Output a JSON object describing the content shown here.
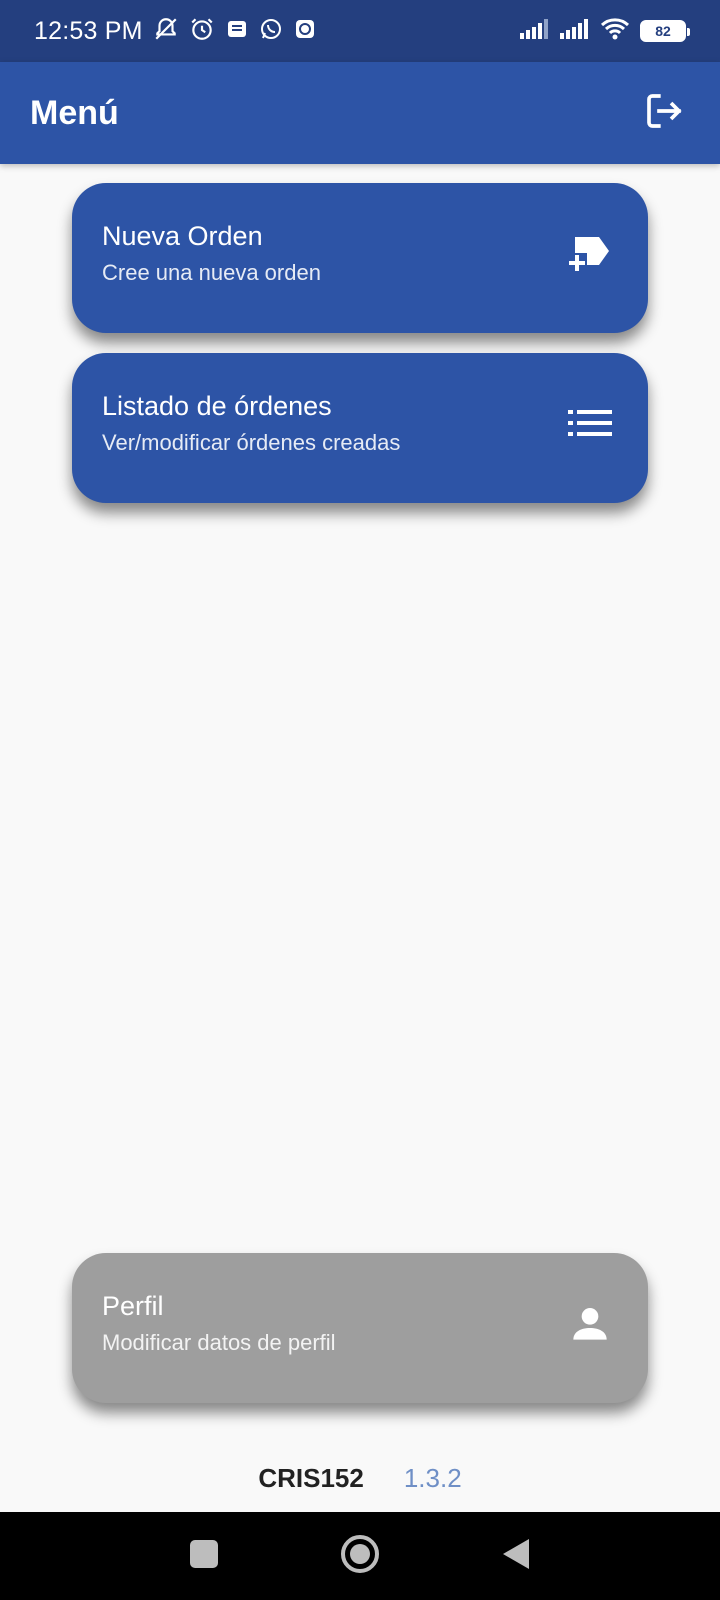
{
  "status_bar": {
    "time": "12:53 PM",
    "battery_level": "82",
    "left_icons": [
      "mute-icon",
      "alarm-icon",
      "message-icon",
      "whatsapp-icon",
      "chat-icon"
    ],
    "right_icons": [
      "signal-icon",
      "signal-icon",
      "wifi-icon",
      "battery-icon"
    ]
  },
  "app_bar": {
    "title": "Menú",
    "logout_icon": "logout-icon"
  },
  "menu": {
    "items": [
      {
        "title": "Nueva Orden",
        "subtitle": "Cree una nueva orden",
        "icon": "new-order-icon",
        "color": "#2d54a6"
      },
      {
        "title": "Listado de órdenes",
        "subtitle": "Ver/modificar órdenes creadas",
        "icon": "list-icon",
        "color": "#2d54a6"
      },
      {
        "title": "Perfil",
        "subtitle": "Modificar datos de perfil",
        "icon": "person-icon",
        "color": "#9e9e9e"
      }
    ]
  },
  "footer": {
    "username": "CRIS152",
    "version": "1.3.2"
  },
  "nav_bar": {
    "buttons": [
      "recents-button",
      "home-button",
      "back-button"
    ]
  },
  "colors": {
    "primary": "#2d54a6",
    "status_bar": "#243f7f",
    "background": "#f9f9f9",
    "disabled_card": "#9e9e9e",
    "version_text": "#6f8fc6"
  }
}
